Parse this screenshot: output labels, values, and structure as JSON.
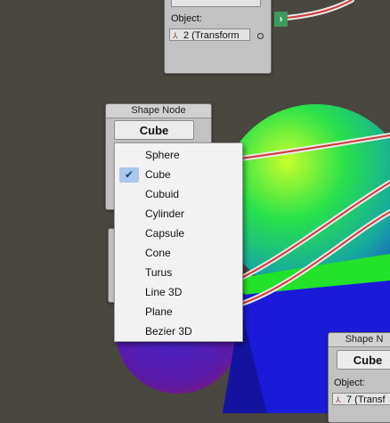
{
  "top_node": {
    "object_label": "Object:",
    "object_value": "2 (Transform",
    "port_icon": "chevron-right-icon"
  },
  "shape_node_left": {
    "title": "Shape Node",
    "shape_value": "Cube"
  },
  "shape_node_right": {
    "title": "Shape N",
    "shape_value": "Cube",
    "object_label": "Object:",
    "object_value": "7 (Transf"
  },
  "dropdown": {
    "selected": "Cube",
    "items": [
      {
        "label": "Sphere",
        "selected": false
      },
      {
        "label": "Cube",
        "selected": true
      },
      {
        "label": "Cubuid",
        "selected": false
      },
      {
        "label": "Cylinder",
        "selected": false
      },
      {
        "label": "Capsule",
        "selected": false
      },
      {
        "label": "Cone",
        "selected": false
      },
      {
        "label": "Turus",
        "selected": false
      },
      {
        "label": "Line 3D",
        "selected": false
      },
      {
        "label": "Plane",
        "selected": false
      },
      {
        "label": "Bezier 3D",
        "selected": false
      }
    ]
  },
  "colors": {
    "background": "#4a4640",
    "port": "#3f9a5a",
    "selection": "#a9c8ec",
    "connection": "#d23a3a"
  }
}
